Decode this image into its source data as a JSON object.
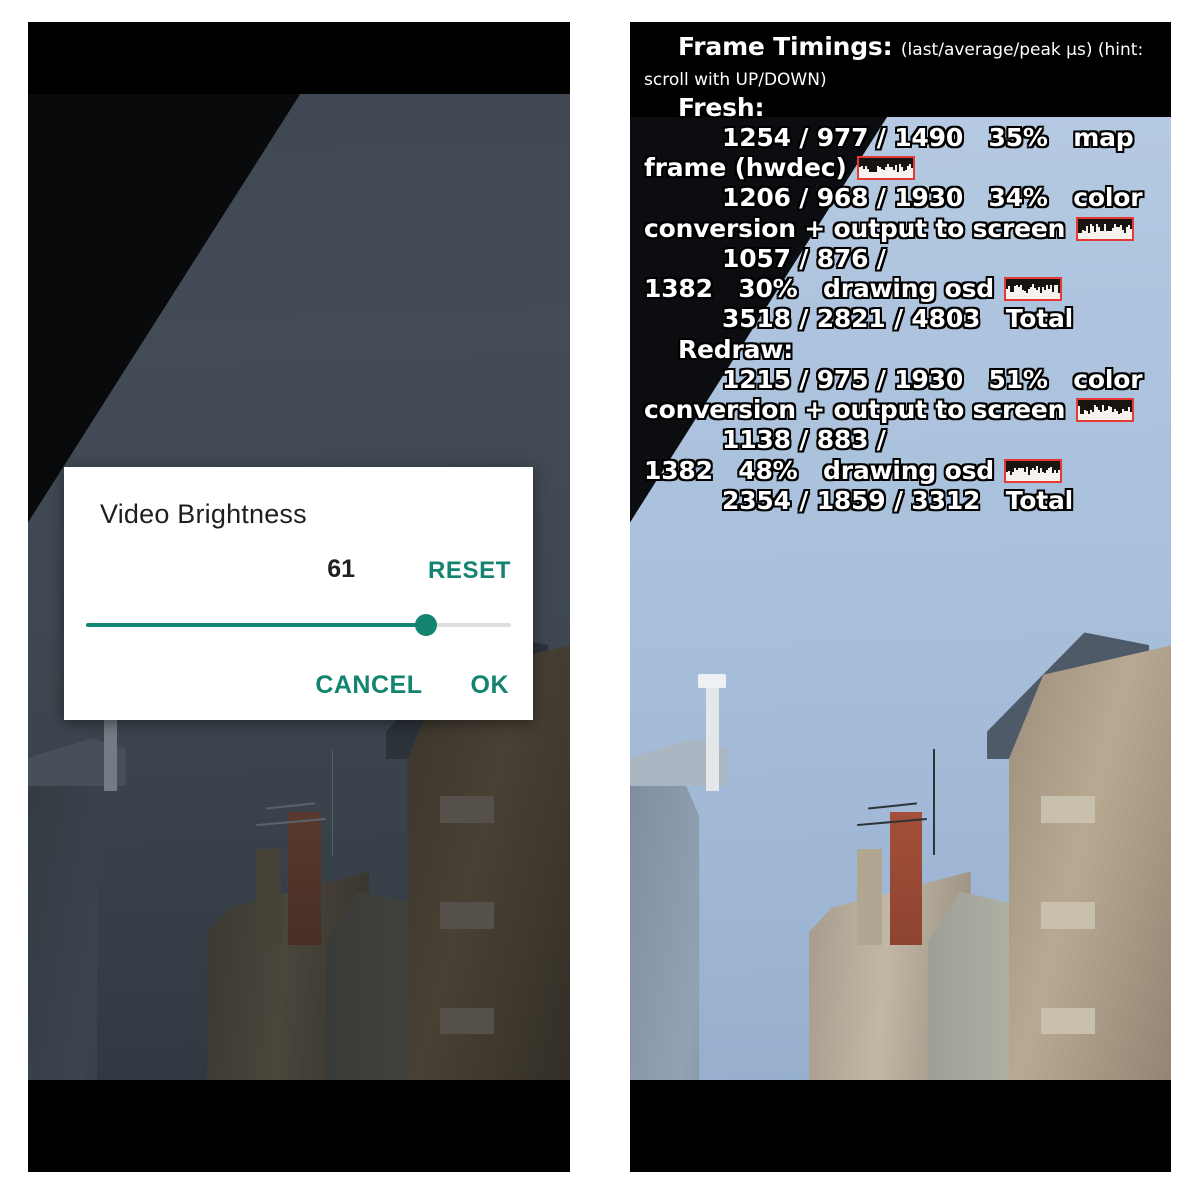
{
  "left_panel": {
    "name": "video-player-with-brightness-dialog",
    "dialog": {
      "title": "Video Brightness",
      "value": "61",
      "value_number": 61,
      "reset_label": "RESET",
      "cancel_label": "CANCEL",
      "ok_label": "OK",
      "accent_color": "#12846f",
      "slider_percent": 80
    }
  },
  "right_panel": {
    "name": "video-player-with-frame-timings-osd",
    "osd": {
      "header_title": "Frame Timings:",
      "header_note": "(last/average/peak µs) (hint: scroll with UP/DOWN)",
      "sections": [
        {
          "label": "Fresh:",
          "rows": [
            {
              "timings": "1254 /   977 /  1490",
              "percent": "35%",
              "name": "map frame (hwdec)",
              "has_graph": true
            },
            {
              "timings": "1206 /   968 /  1930",
              "percent": "34%",
              "name": "color conversion + output to screen",
              "has_graph": true
            },
            {
              "timings": "1057 /   876 /  1382",
              "percent": "30%",
              "name": "drawing osd",
              "has_graph": true
            },
            {
              "timings": "3518 / 2821 / 4803",
              "percent": "",
              "name": "Total",
              "has_graph": false
            }
          ]
        },
        {
          "label": "Redraw:",
          "rows": [
            {
              "timings": "1215 /   975 /  1930",
              "percent": "51%",
              "name": "color conversion + output to screen",
              "has_graph": true
            },
            {
              "timings": "1138 /   883 /  1382",
              "percent": "48%",
              "name": "drawing osd",
              "has_graph": true
            },
            {
              "timings": "2354 /  1859 /  3312",
              "percent": "",
              "name": "Total",
              "has_graph": false
            }
          ]
        }
      ],
      "graph_border_color": "#e53935",
      "text_color": "#ffffff",
      "outline_color": "#000000"
    }
  }
}
